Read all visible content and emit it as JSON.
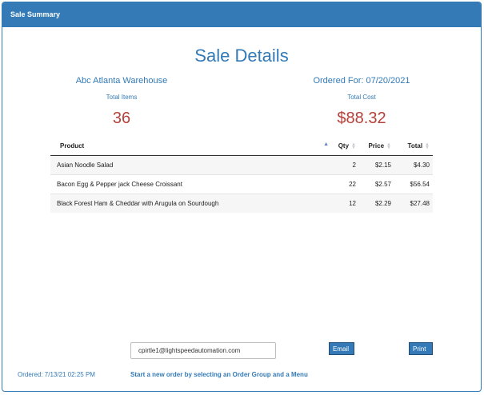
{
  "header": {
    "title": "Sale Summary"
  },
  "main": {
    "title": "Sale Details",
    "warehouse": "Abc Atlanta Warehouse",
    "ordered_for": "Ordered For: 07/20/2021",
    "total_items_label": "Total Items",
    "total_items": "36",
    "total_cost_label": "Total Cost",
    "total_cost": "$88.32"
  },
  "table": {
    "headers": {
      "product": "Product",
      "qty": "Qty",
      "price": "Price",
      "total": "Total"
    },
    "rows": [
      {
        "product": "Asian Noodle Salad",
        "qty": "2",
        "price": "$2.15",
        "total": "$4.30"
      },
      {
        "product": "Bacon Egg & Pepper jack Cheese Croissant",
        "qty": "22",
        "price": "$2.57",
        "total": "$56.54"
      },
      {
        "product": "Black Forest Ham & Cheddar with Arugula on Sourdough",
        "qty": "12",
        "price": "$2.29",
        "total": "$27.48"
      }
    ]
  },
  "footer": {
    "email_value": "cpirtle1@lightspeedautomation.com",
    "email_button": "Email",
    "print_button": "Print",
    "ordered": "Ordered: 7/13/21 02:25 PM",
    "new_order": "Start a new order by selecting an Order Group and a Menu"
  },
  "colors": {
    "accent": "#337ab7",
    "value": "#b5403a"
  },
  "icons": {
    "sort": "sort-icon",
    "sort_asc": "sort-asc-icon"
  }
}
